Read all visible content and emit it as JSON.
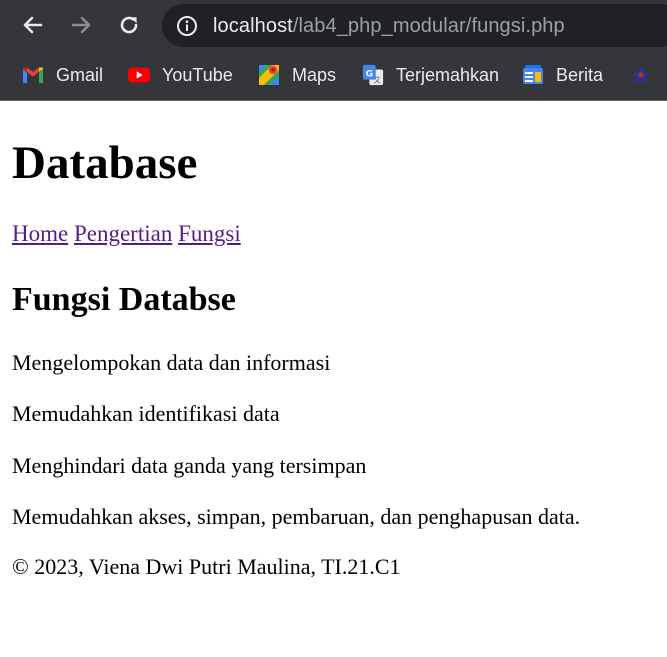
{
  "browser": {
    "url_host": "localhost",
    "url_path": "/lab4_php_modular/fungsi.php",
    "bookmarks": [
      {
        "label": "Gmail",
        "icon": "gmail-icon"
      },
      {
        "label": "YouTube",
        "icon": "youtube-icon"
      },
      {
        "label": "Maps",
        "icon": "maps-icon"
      },
      {
        "label": "Terjemahkan",
        "icon": "translate-icon"
      },
      {
        "label": "Berita",
        "icon": "news-icon"
      },
      {
        "label": "",
        "icon": "site-favicon"
      }
    ],
    "colors": {
      "chrome_bg": "#35363a",
      "omnibox_bg": "#202124",
      "link_visited": "#551a8b"
    }
  },
  "page": {
    "title": "Database",
    "nav": [
      {
        "label": "Home"
      },
      {
        "label": "Pengertian"
      },
      {
        "label": "Fungsi"
      }
    ],
    "heading": "Fungsi Databse",
    "paragraphs": [
      "Mengelompokan data dan informasi",
      "Memudahkan identifikasi data",
      "Menghindari data ganda yang tersimpan",
      "Memudahkan akses, simpan, pembaruan, dan penghapusan data."
    ],
    "footer": "© 2023, Viena Dwi Putri Maulina, TI.21.C1"
  }
}
